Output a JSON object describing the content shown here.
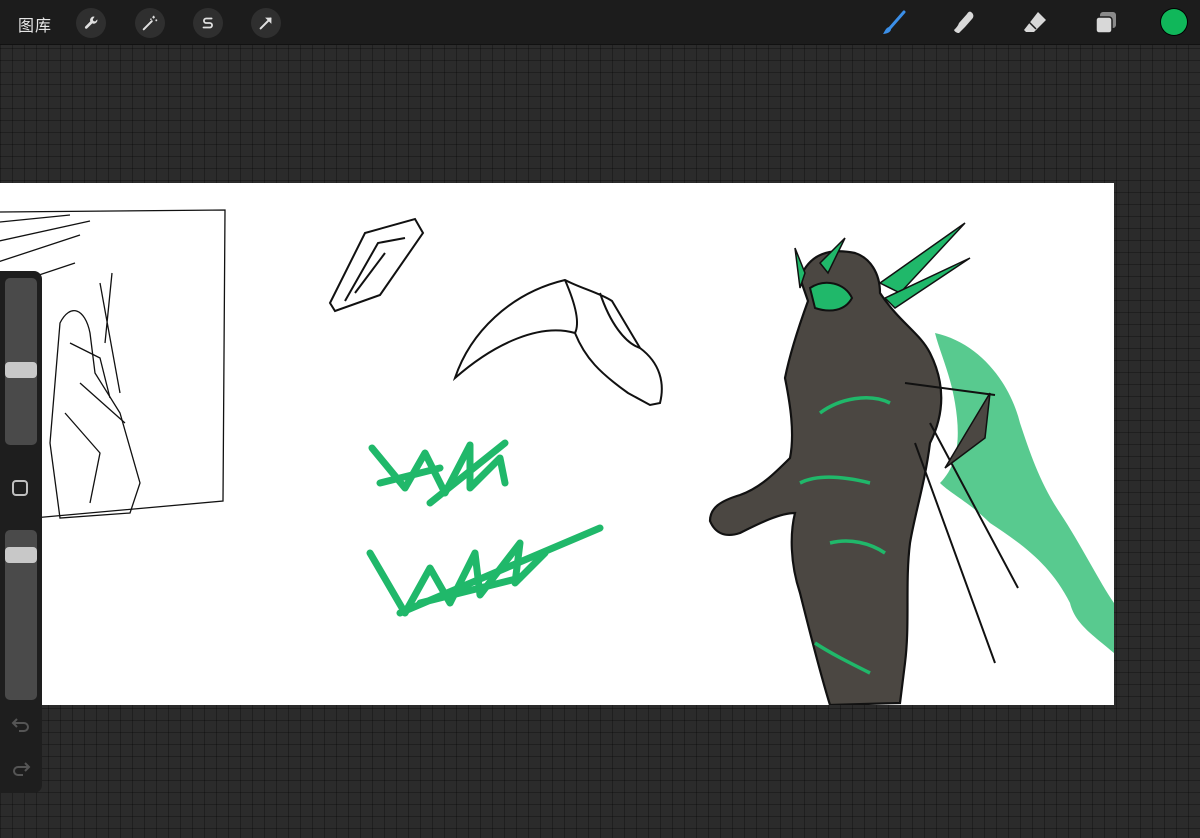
{
  "toolbar": {
    "gallery_label": "图库",
    "left_icons": [
      "wrench-icon",
      "magic-wand-icon",
      "selection-s-icon",
      "transform-arrow-icon"
    ],
    "right_icons": [
      "brush-icon",
      "smudge-icon",
      "eraser-icon",
      "layers-icon"
    ],
    "active_tool": "brush",
    "active_color": "#10b75a"
  },
  "sidebar": {
    "size_slider_level": 0.45,
    "opacity_slider_level": 0.12,
    "icons": [
      "modifier-square-icon",
      "undo-icon",
      "redo-icon"
    ]
  },
  "canvas": {
    "accent_color": "#20b86a",
    "background": "#ffffff"
  }
}
